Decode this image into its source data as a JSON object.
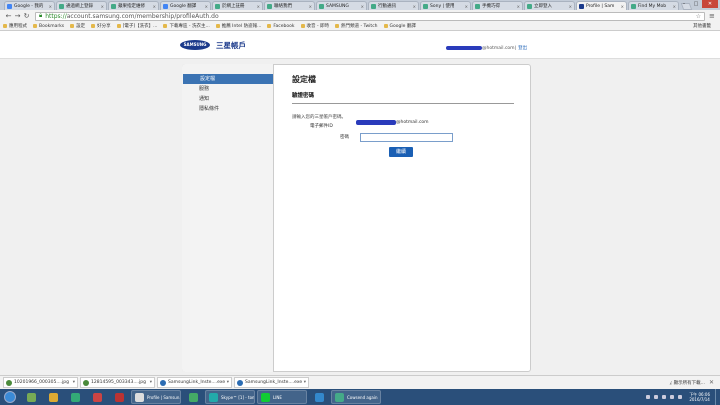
{
  "browser": {
    "tabs": [
      {
        "label": "Google - 我的",
        "icon": "g"
      },
      {
        "label": "通過網上登錄",
        "icon": "n"
      },
      {
        "label": "蘋果指定維修",
        "icon": "n"
      },
      {
        "label": "Google 翻譯",
        "icon": "g"
      },
      {
        "label": "於網上註冊",
        "icon": "n"
      },
      {
        "label": "聯絡我們",
        "icon": "n"
      },
      {
        "label": "SAMSUNG",
        "icon": "n"
      },
      {
        "label": "行動通訊",
        "icon": "n"
      },
      {
        "label": "Sony | 使用",
        "icon": "n"
      },
      {
        "label": "手機巧得",
        "icon": "n"
      },
      {
        "label": "立即登入",
        "icon": "n"
      },
      {
        "label": "Profile | Sam",
        "icon": "s"
      },
      {
        "label": "Find My Mob",
        "icon": "n"
      }
    ],
    "active_tab": 11,
    "url_https": "https://",
    "url_rest": "account.samsung.com/membership/profileAuth.do",
    "bookmarks": [
      "應用程式",
      "Bookmarks",
      "設定",
      "好分享",
      "[電子]【洗衣】...",
      "下載專區 - 洗衣主...",
      "推薦 Intel 防盜報...",
      "Facebook",
      "收音 - 即時",
      "熱門頻道 - Twitch",
      "Google 翻譯"
    ],
    "other_bookmarks": "其他書籤"
  },
  "header": {
    "logo_text": "SAMSUNG",
    "title": "三星帳戶",
    "email_suffix": "@hotmail.com",
    "separator": " | ",
    "logout": "登出"
  },
  "sidebar": {
    "items": [
      "設定檔",
      "服務",
      "通知",
      "隱私條件"
    ],
    "active": 0
  },
  "main": {
    "title": "設定檔",
    "subtitle": "驗證密碼",
    "prompt": "請輸入您的三星帳戶密碼。",
    "email_label": "電子郵件ID",
    "email_suffix": "@hotmail.com",
    "password_label": "密碼",
    "confirm_button": "繼續"
  },
  "downloads": {
    "items": [
      {
        "name": "10201966_000305....jpg",
        "type": "img"
      },
      {
        "name": "12814595_003343....jpg",
        "type": "img"
      },
      {
        "name": "SamsungLink_Inste....exe",
        "type": "exe"
      },
      {
        "name": "SamsungLink_Inste....exe",
        "type": "exe"
      }
    ],
    "show_all": "顯示所有下載..."
  },
  "taskbar": {
    "items": [
      {
        "label": "",
        "color": "#7a5"
      },
      {
        "label": "",
        "color": "#da3"
      },
      {
        "label": "",
        "color": "#3a7"
      },
      {
        "label": "",
        "color": "#c44"
      },
      {
        "label": "",
        "color": "#b33"
      },
      {
        "label": "Profile | Samsun...",
        "color": "#ddd"
      },
      {
        "label": "",
        "color": "#4a6"
      },
      {
        "label": "Skype™ [1] - tom...",
        "color": "#2aa"
      },
      {
        "label": "LINE",
        "color": "#1c3"
      },
      {
        "label": "",
        "color": "#38c"
      },
      {
        "label": "Cowsend again",
        "color": "#4a8"
      }
    ],
    "time": "下午 06:06",
    "date": "2016/7/14"
  }
}
